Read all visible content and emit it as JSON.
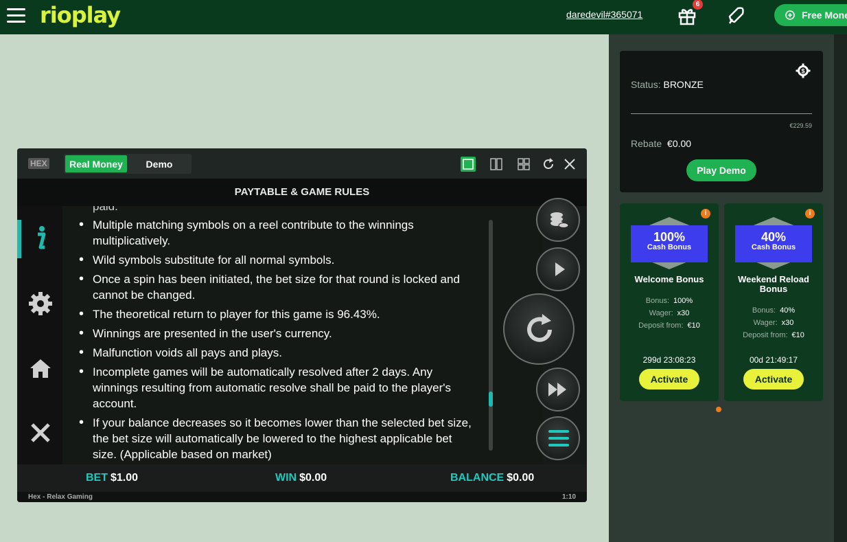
{
  "header": {
    "logo": "rioplay",
    "username": "daredevil#365071",
    "gift_count": "6",
    "free_money_label": "Free Money"
  },
  "status_card": {
    "status_label": "Status:",
    "status_value": "BRONZE",
    "progress_value": "€229.59",
    "rebate_label": "Rebate",
    "rebate_value": "€0.00",
    "play_demo_label": "Play Demo"
  },
  "bonuses": [
    {
      "percent": "100%",
      "type": "Cash Bonus",
      "title": "Welcome Bonus",
      "bonus_label": "Bonus:",
      "bonus_value": "100%",
      "wager_label": "Wager:",
      "wager_value": "x30",
      "deposit_label": "Deposit from:",
      "deposit_value": "€10",
      "timer": "299d  23:08:23",
      "activate_label": "Activate"
    },
    {
      "percent": "40%",
      "type": "Cash Bonus",
      "title": "Weekend Reload Bonus",
      "bonus_label": "Bonus:",
      "bonus_value": "40%",
      "wager_label": "Wager:",
      "wager_value": "x30",
      "deposit_label": "Deposit from:",
      "deposit_value": "€10",
      "timer": "00d  21:49:17",
      "activate_label": "Activate"
    }
  ],
  "game": {
    "tag": "HEX",
    "mode_real": "Real Money",
    "mode_demo": "Demo",
    "title": "PAYTABLE & GAME RULES",
    "clipped_text": "paid.",
    "rules": [
      "Multiple matching symbols on a reel contribute to the winnings multiplicatively.",
      "Wild symbols substitute for all normal symbols.",
      "Once a spin has been initiated, the bet size for that round is locked and cannot be changed.",
      "The theoretical return to player for this game is 96.43%.",
      "Winnings are presented in the user's currency.",
      "Malfunction voids all pays and plays.",
      "Incomplete games will be automatically resolved after 2 days. Any winnings resulting from automatic resolve shall be paid to the player's account.",
      "If your balance decreases so it becomes lower than the selected bet size, the bet size will automatically be lowered to the highest applicable bet size. (Applicable based on market)"
    ],
    "footer": {
      "bet_label": "BET",
      "bet_value": "$1.00",
      "win_label": "WIN",
      "win_value": "$0.00",
      "balance_label": "BALANCE",
      "balance_value": "$0.00"
    },
    "status_left": "Hex - Relax Gaming",
    "status_right": "1:10"
  },
  "colors": {
    "brand_green": "#1fb152",
    "logo_yellow": "#d9f23a",
    "accent_teal": "#1ec9bd",
    "bonus_blue": "#3d3dee"
  }
}
